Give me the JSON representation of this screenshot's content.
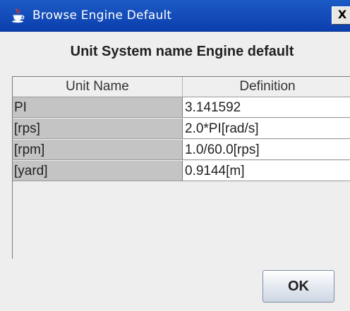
{
  "window": {
    "title": "Browse Engine Default",
    "close_label": "X"
  },
  "heading": "Unit System name  Engine default",
  "table": {
    "columns": [
      "Unit Name",
      "Definition"
    ],
    "rows": [
      {
        "name": "PI",
        "definition": "3.141592"
      },
      {
        "name": "[rps]",
        "definition": "2.0*PI[rad/s]"
      },
      {
        "name": "[rpm]",
        "definition": "1.0/60.0[rps]"
      },
      {
        "name": "[yard]",
        "definition": "0.9144[m]"
      }
    ]
  },
  "buttons": {
    "ok_label": "OK"
  },
  "colors": {
    "titlebar": "#0b3fae",
    "name_cell_bg": "#c4c4c4",
    "definition_cell_bg": "#ffffff",
    "dialog_bg": "#eeeeee"
  },
  "icons": {
    "title_icon": "java-coffee-cup-icon",
    "close_icon": "close-icon"
  }
}
